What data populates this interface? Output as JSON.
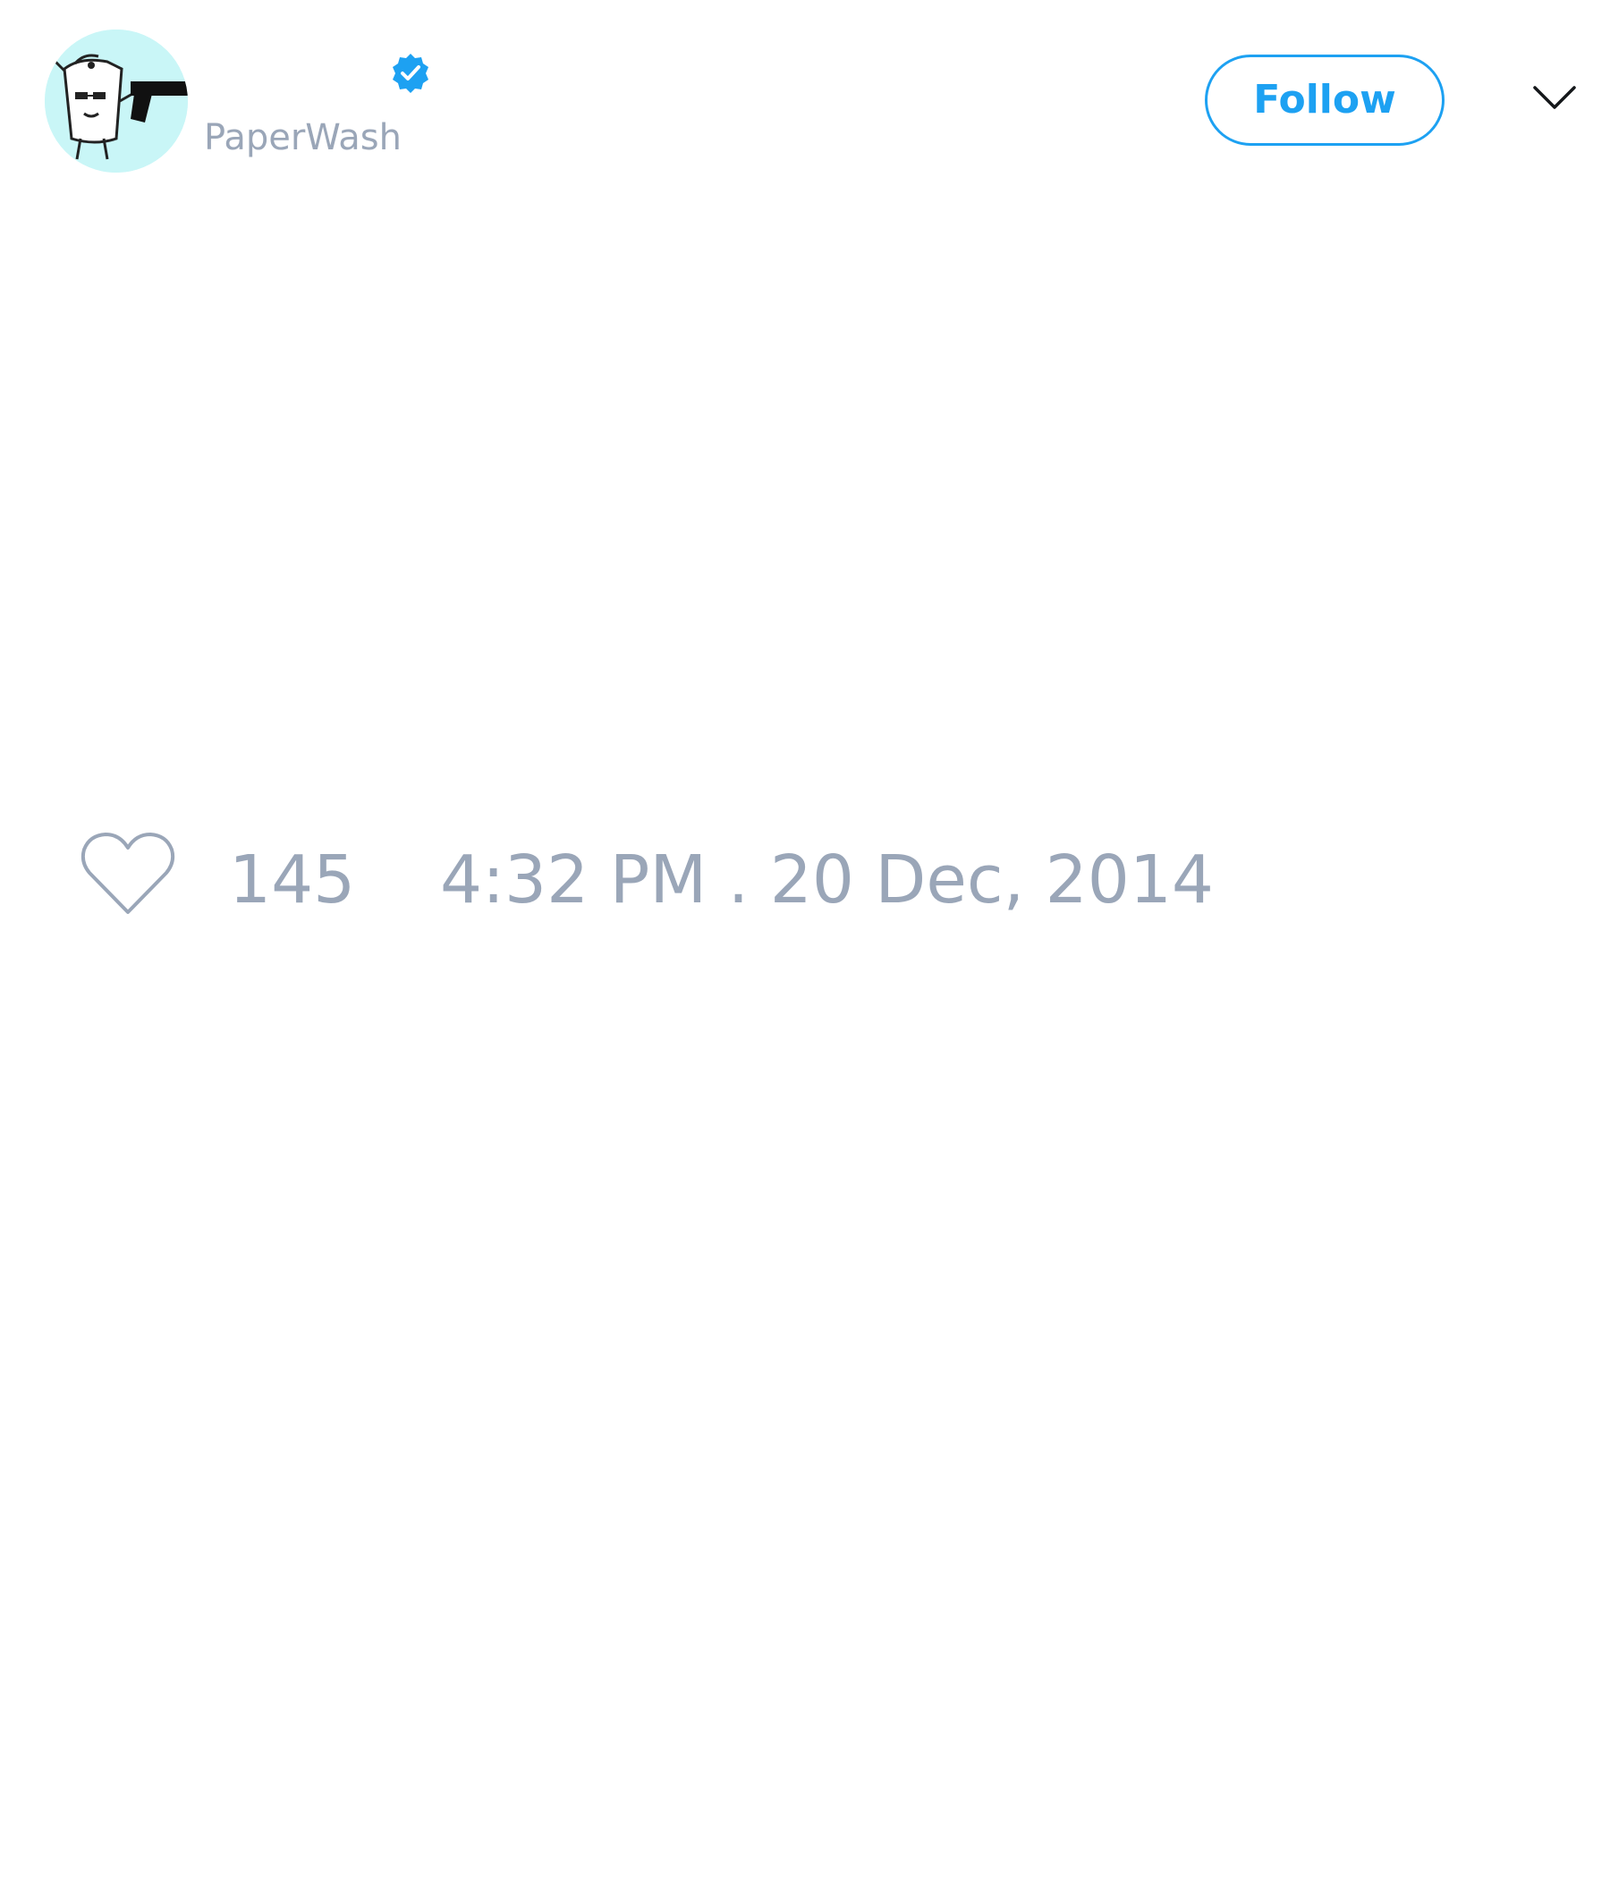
{
  "tweet": {
    "author": {
      "display_name": "",
      "handle": "PaperWash",
      "verified": true,
      "verified_icon": "verified-badge-icon",
      "avatar_icon": "avatar-paper-character-with-gun"
    },
    "follow_label": "Follow",
    "menu_icon": "chevron-down-icon",
    "likes": {
      "icon": "heart-outline-icon",
      "count": "145"
    },
    "timestamp": "4:32 PM . 20 Dec, 2014"
  },
  "colors": {
    "accent": "#1da1f2",
    "muted_text": "#9aa6b8",
    "background": "#ffffff",
    "avatar_background": "#c9f6f7"
  }
}
